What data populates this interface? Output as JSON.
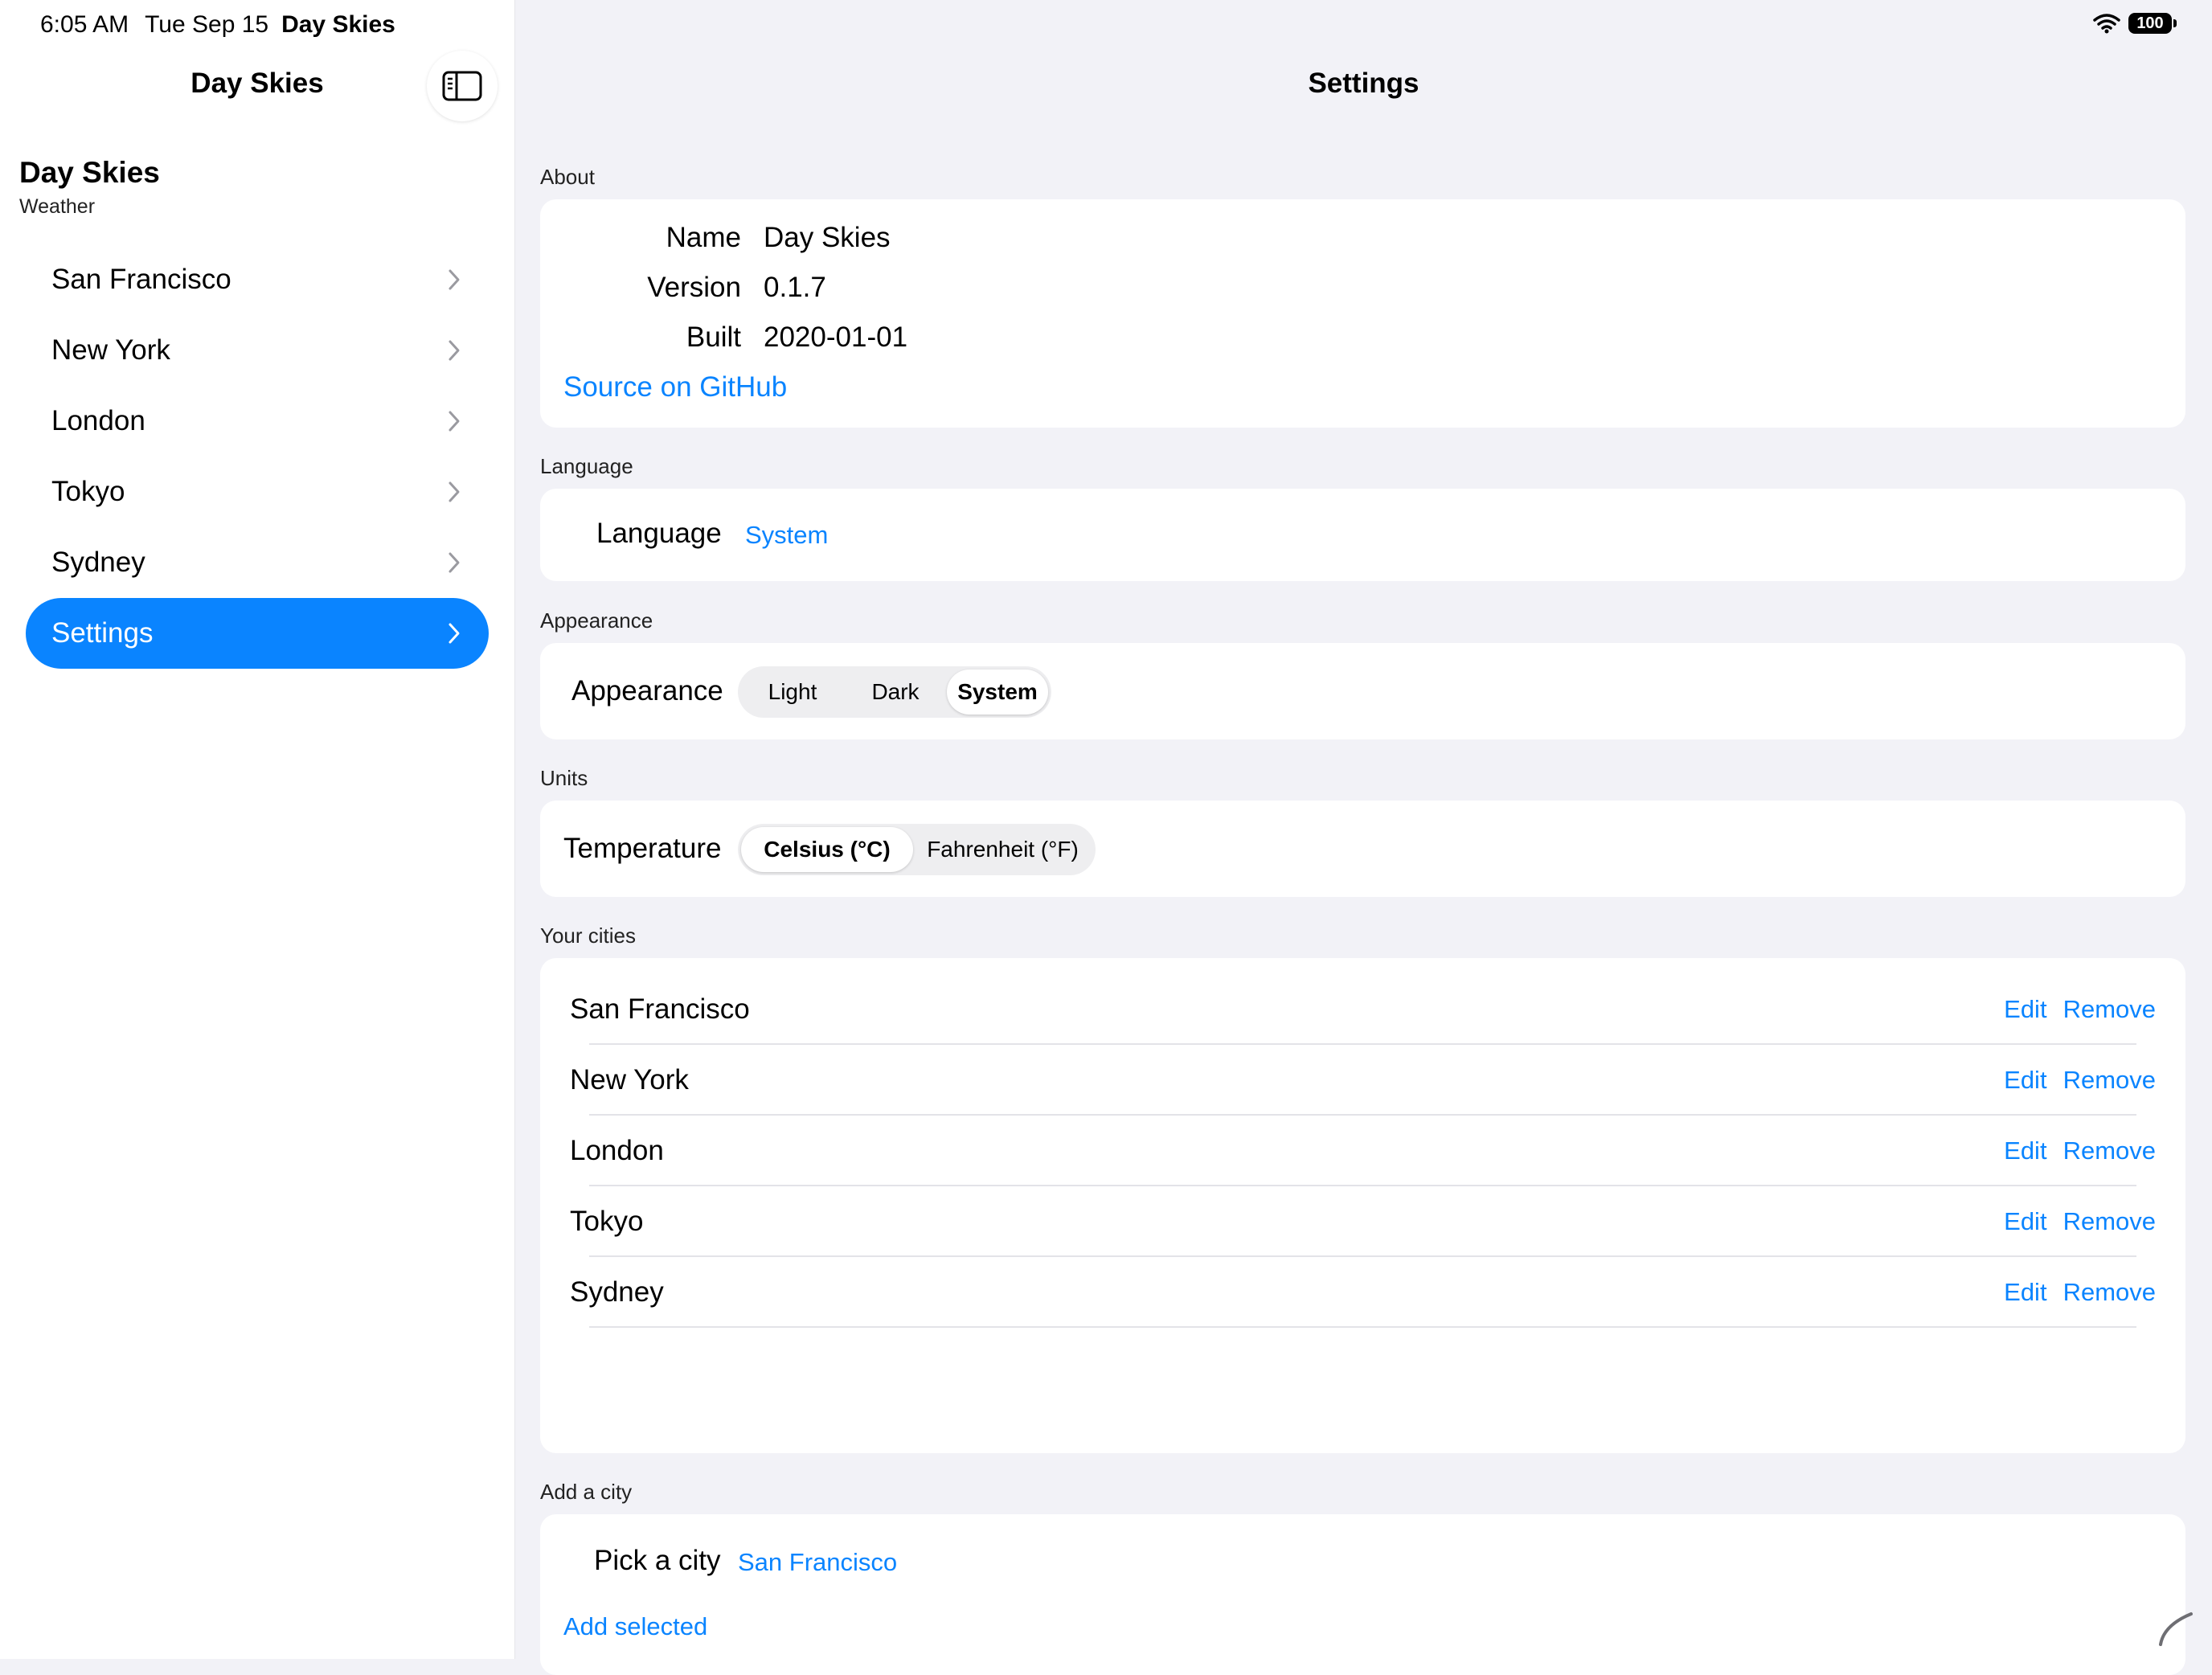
{
  "status": {
    "time": "6:05 AM",
    "date": "Tue Sep 15",
    "app": "Day Skies",
    "battery": "100"
  },
  "sidebar": {
    "title": "Day Skies",
    "app_name": "Day Skies",
    "app_subtitle": "Weather",
    "items": [
      {
        "label": "San Francisco"
      },
      {
        "label": "New York"
      },
      {
        "label": "London"
      },
      {
        "label": "Tokyo"
      },
      {
        "label": "Sydney"
      },
      {
        "label": "Settings",
        "selected": true
      }
    ]
  },
  "main": {
    "title": "Settings",
    "about": {
      "label": "About",
      "name_key": "Name",
      "name_val": "Day Skies",
      "version_key": "Version",
      "version_val": "0.1.7",
      "built_key": "Built",
      "built_val": "2020-01-01",
      "source_link": "Source on GitHub"
    },
    "language": {
      "label": "Language",
      "field": "Language",
      "value": "System"
    },
    "appearance": {
      "label": "Appearance",
      "field": "Appearance",
      "options": [
        "Light",
        "Dark",
        "System"
      ],
      "selected": "System"
    },
    "units": {
      "label": "Units",
      "field": "Temperature",
      "options": [
        "Celsius (°C)",
        "Fahrenheit (°F)"
      ],
      "selected": "Celsius (°C)"
    },
    "cities": {
      "label": "Your cities",
      "edit_label": "Edit",
      "remove_label": "Remove",
      "items": [
        "San Francisco",
        "New York",
        "London",
        "Tokyo",
        "Sydney"
      ]
    },
    "add_city": {
      "label": "Add a city",
      "field": "Pick a city",
      "value": "San Francisco",
      "add_button": "Add selected"
    }
  },
  "colors": {
    "accent": "#0a84ff",
    "background": "#f2f2f7"
  }
}
